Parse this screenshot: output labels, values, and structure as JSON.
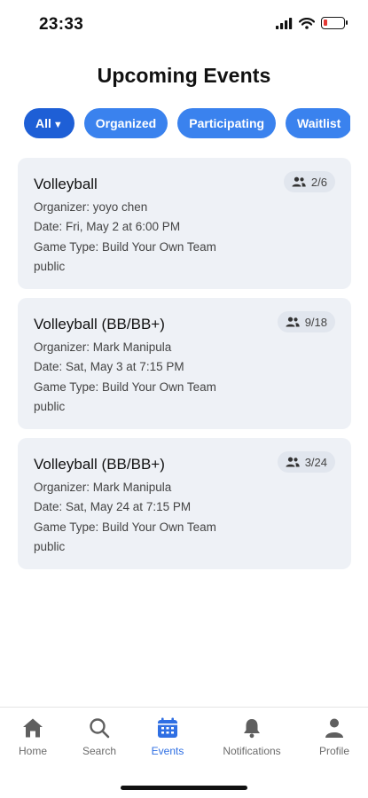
{
  "status_bar": {
    "time": "23:33",
    "battery_color": "#e53935"
  },
  "page": {
    "title": "Upcoming Events"
  },
  "filters": [
    {
      "label": "All",
      "caret": "▼"
    },
    {
      "label": "Organized"
    },
    {
      "label": "Participating"
    },
    {
      "label": "Waitlist"
    }
  ],
  "events": [
    {
      "title": "Volleyball",
      "organizer": "Organizer: yoyo chen",
      "date": "Date: Fri, May 2 at 6:00 PM",
      "game_type": "Game Type: Build Your Own Team",
      "visibility": "public",
      "count": "2/6"
    },
    {
      "title": "Volleyball (BB/BB+)",
      "organizer": "Organizer: Mark Manipula",
      "date": "Date: Sat, May 3 at 7:15 PM",
      "game_type": "Game Type: Build Your Own Team",
      "visibility": "public",
      "count": "9/18"
    },
    {
      "title": "Volleyball (BB/BB+)",
      "organizer": "Organizer: Mark Manipula",
      "date": "Date: Sat, May 24 at 7:15 PM",
      "game_type": "Game Type: Build Your Own Team",
      "visibility": "public",
      "count": "3/24"
    }
  ],
  "tabs": [
    {
      "label": "Home",
      "icon": "home-icon"
    },
    {
      "label": "Search",
      "icon": "search-icon"
    },
    {
      "label": "Events",
      "icon": "calendar-icon",
      "active": true
    },
    {
      "label": "Notifications",
      "icon": "bell-icon"
    },
    {
      "label": "Profile",
      "icon": "person-icon"
    }
  ],
  "colors": {
    "accent": "#3a82ee",
    "accent_active": "#1e5fd6",
    "card_bg": "#eef1f6",
    "tab_active": "#2f6fe3"
  }
}
